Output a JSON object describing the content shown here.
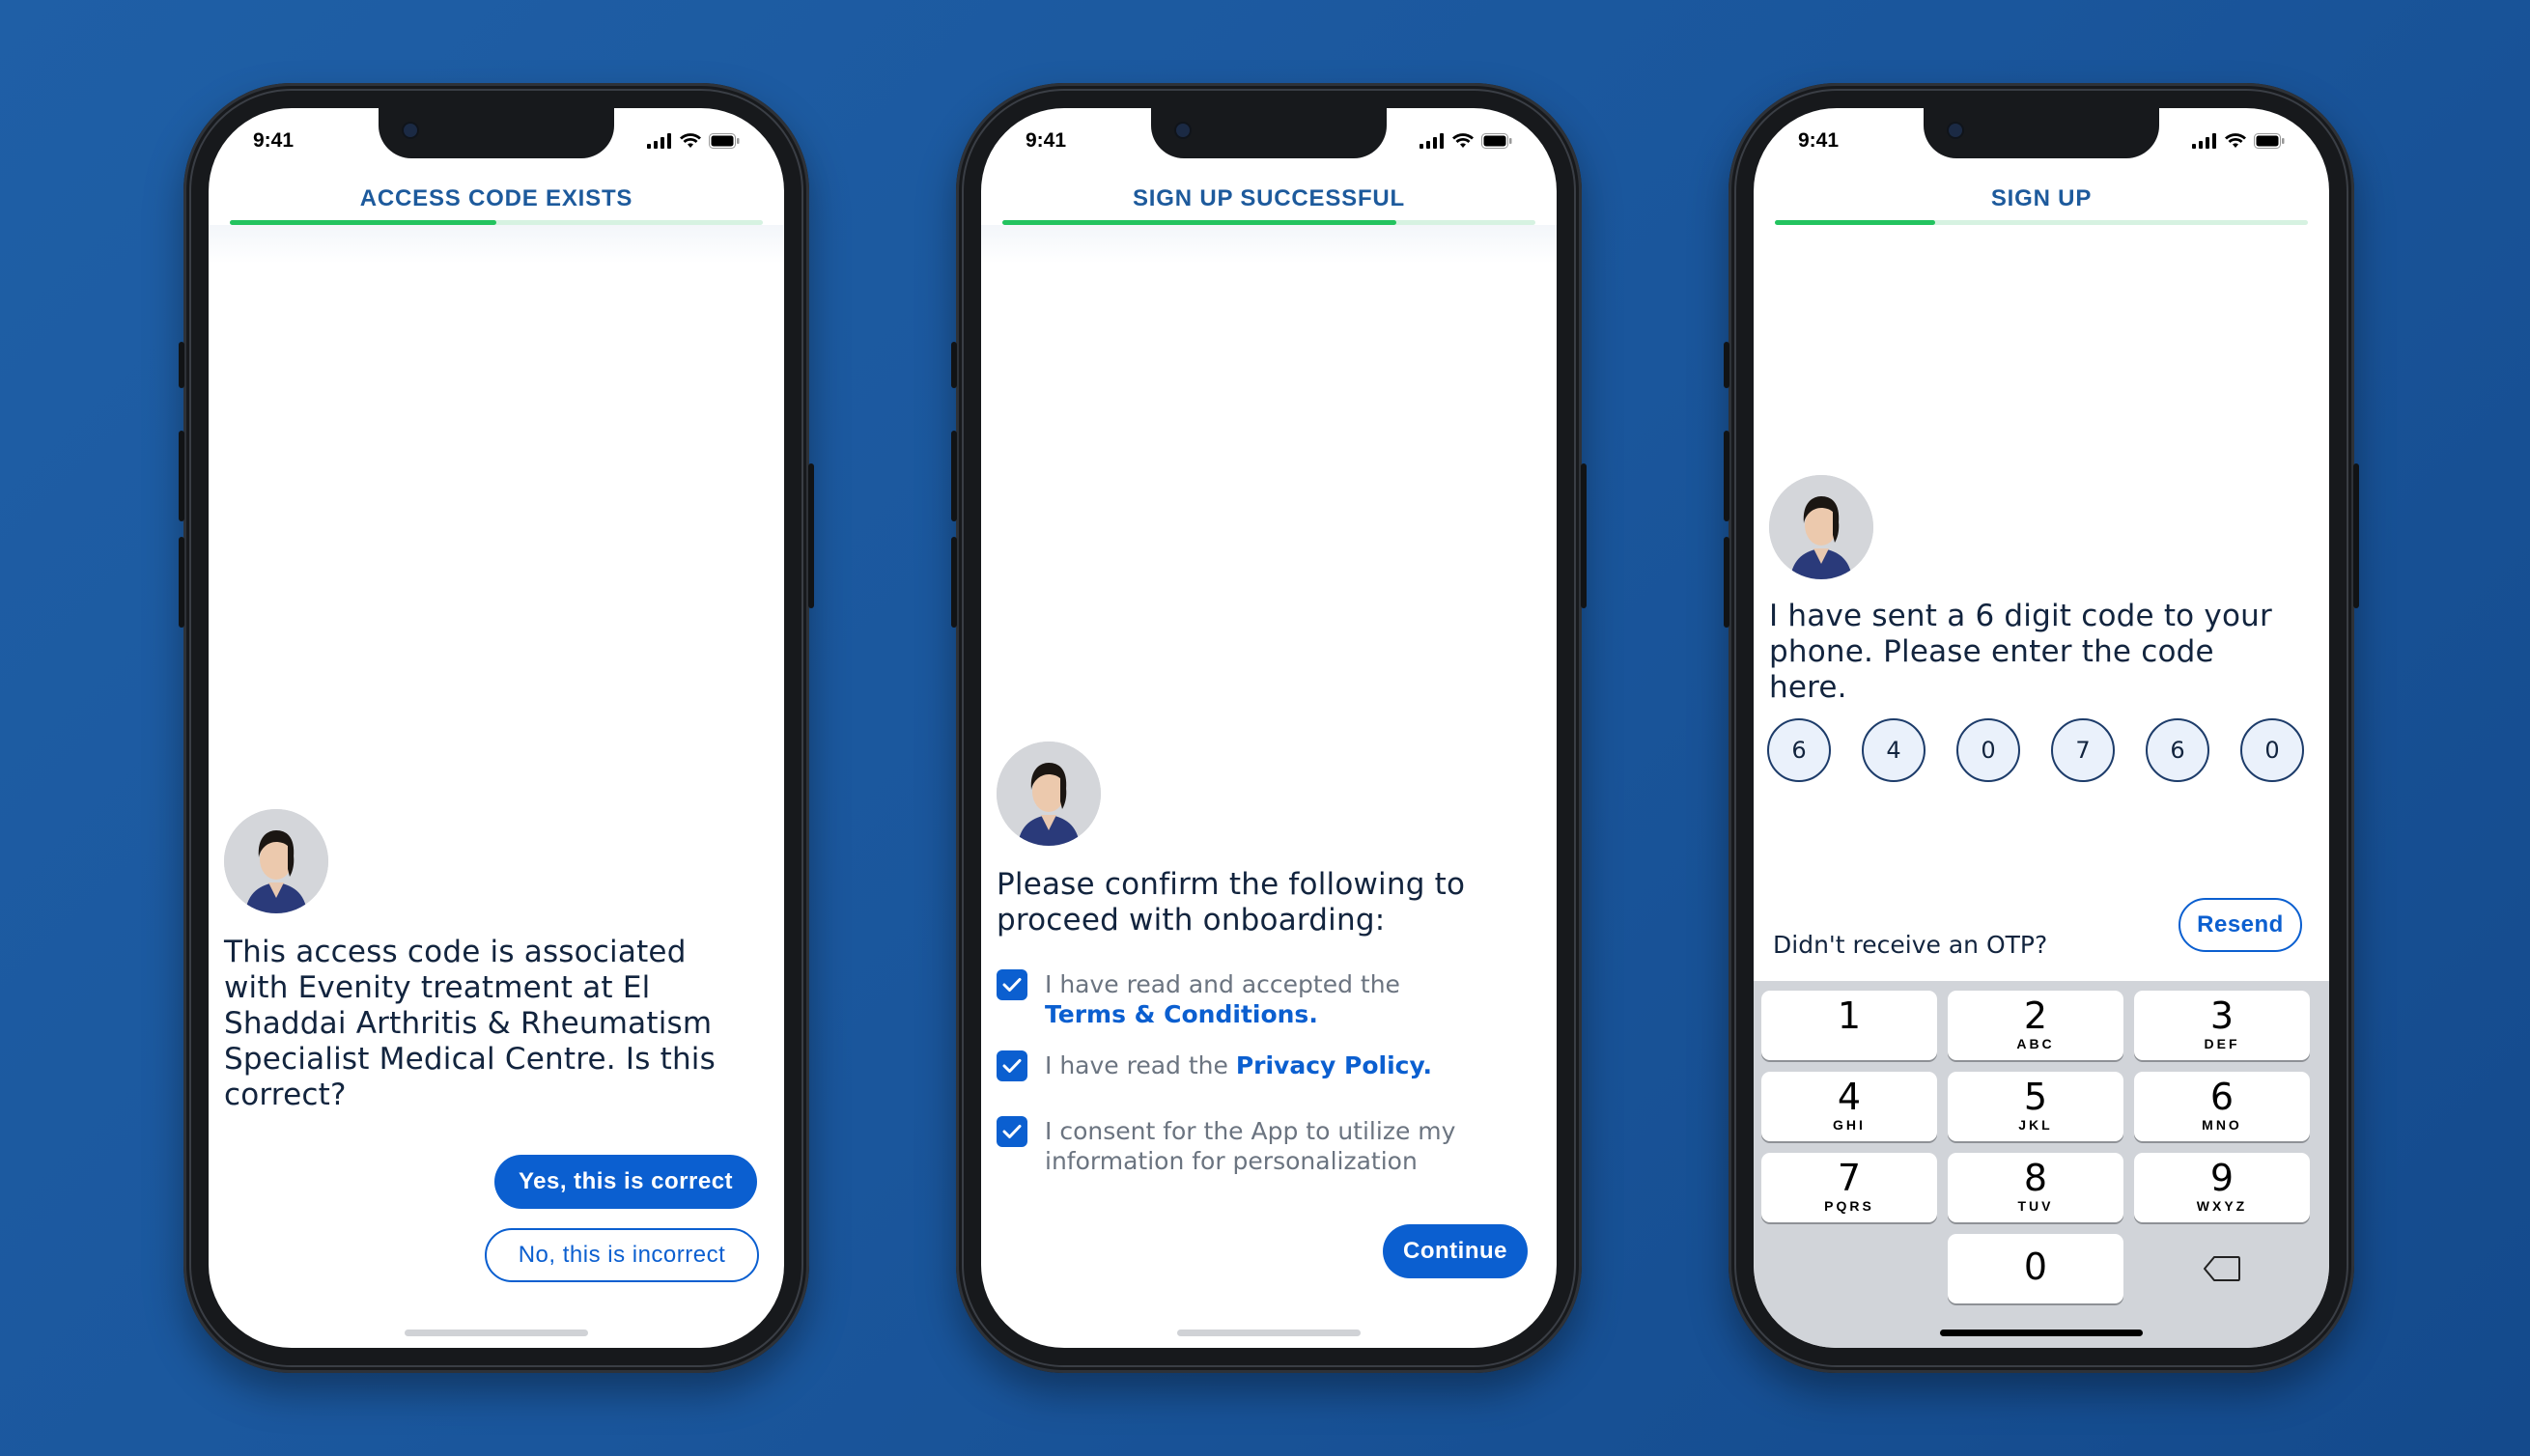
{
  "status": {
    "time": "9:41"
  },
  "screen1": {
    "title": "ACCESS CODE EXISTS",
    "progress": 0.5,
    "message": "This access code is associated with Evenity treatment at El Shaddai Arthritis & Rheumatism Specialist Medical Centre. Is this correct?",
    "yes_label": "Yes, this is correct",
    "no_label": "No, this is incorrect"
  },
  "screen2": {
    "title": "SIGN UP SUCCESSFUL",
    "progress": 0.74,
    "message": "Please confirm the following to proceed with onboarding:",
    "items": [
      {
        "text": "I have read and accepted the ",
        "link": "Terms & Conditions.",
        "checked": true
      },
      {
        "text": "I have read the ",
        "link": "Privacy Policy.",
        "checked": true
      },
      {
        "text": "I consent for the App to utilize my information for personalization",
        "link": "",
        "checked": true
      }
    ],
    "continue_label": "Continue"
  },
  "screen3": {
    "title": "SIGN UP",
    "progress": 0.3,
    "message": "I have sent a 6 digit code to your phone. Please enter the code here.",
    "otp": [
      "6",
      "4",
      "0",
      "7",
      "6",
      "0"
    ],
    "resend_prompt": "Didn't receive an OTP?",
    "resend_label": "Resend",
    "keys": [
      {
        "num": "1",
        "letters": ""
      },
      {
        "num": "2",
        "letters": "ABC"
      },
      {
        "num": "3",
        "letters": "DEF"
      },
      {
        "num": "4",
        "letters": "GHI"
      },
      {
        "num": "5",
        "letters": "JKL"
      },
      {
        "num": "6",
        "letters": "MNO"
      },
      {
        "num": "7",
        "letters": "PQRS"
      },
      {
        "num": "8",
        "letters": "TUV"
      },
      {
        "num": "9",
        "letters": "WXYZ"
      },
      {
        "num": "0",
        "letters": ""
      }
    ]
  },
  "colors": {
    "background": "#1a569c",
    "accent": "#0b5fd0",
    "title": "#1d5a9c",
    "progress": "#23c35f"
  },
  "icons": [
    "signal-icon",
    "wifi-icon",
    "battery-icon",
    "checkmark-icon",
    "backspace-icon"
  ]
}
